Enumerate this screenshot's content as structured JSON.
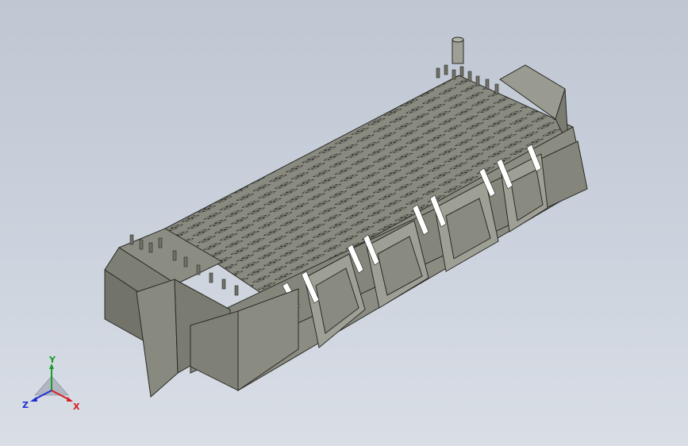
{
  "viewport": {
    "background_top": "#bfc7d3",
    "background_bottom": "#d9dee6"
  },
  "model": {
    "body_color": "#8e8f84",
    "shadow_color": "#6f7066",
    "highlight_color": "#b3b4a9",
    "edge_color": "#2a2a26",
    "contact_rows": 12,
    "contact_cols": 24,
    "slot_count": 5
  },
  "triad": {
    "x_label": "X",
    "y_label": "Y",
    "z_label": "Z",
    "x_color": "#d42020",
    "y_color": "#1a9a2a",
    "z_color": "#2030d0"
  }
}
